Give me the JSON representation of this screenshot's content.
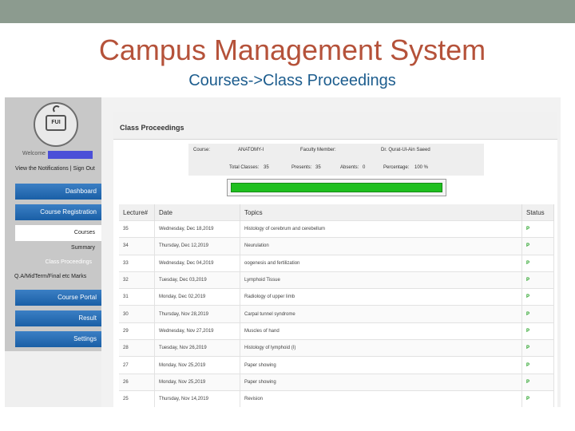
{
  "slide": {
    "title": "Campus Management System",
    "subtitle": "Courses->Class Proceedings"
  },
  "sidebar": {
    "logo_text": "FUI",
    "welcome": "Welcome",
    "notifications_link": "View the Notifications",
    "separator": "|",
    "signout_link": "Sign Out",
    "nav": [
      {
        "label": "Dashboard"
      },
      {
        "label": "Course Registration"
      },
      {
        "label": "Course Portal"
      },
      {
        "label": "Result"
      },
      {
        "label": "Settings"
      }
    ],
    "subitems": [
      {
        "label": "Courses"
      },
      {
        "label": "Summary"
      },
      {
        "label": "Class Proceedings"
      },
      {
        "label": "Q.A/MidTerm/Final etc Marks"
      }
    ]
  },
  "main": {
    "title": "Class Proceedings",
    "info": {
      "course_label": "Course:",
      "course_value": "ANATOMY-I",
      "faculty_label": "Faculty Member:",
      "faculty_value": "Dr. Qurat-Ul-Ain Saeed",
      "total_label": "Total Classes:",
      "total_value": "35",
      "presents_label": "Presents:",
      "presents_value": "35",
      "absents_label": "Absents:",
      "absents_value": "0",
      "percentage_label": "Percentage:",
      "percentage_value": "100 %"
    },
    "progress": 1.0,
    "progress_color": "#1fbf1f",
    "table": {
      "headers": [
        "Lecture#",
        "Date",
        "Topics",
        "Status"
      ],
      "rows": [
        [
          "35",
          "Wednesday, Dec 18,2019",
          "Histology of cerebrum and cerebellum",
          "P"
        ],
        [
          "34",
          "Thursday, Dec 12,2019",
          "Neurulation",
          "P"
        ],
        [
          "33",
          "Wednesday, Dec 04,2019",
          "oogenesis and fertilization",
          "P"
        ],
        [
          "32",
          "Tuesday, Dec 03,2019",
          "Lymphoid Tissue",
          "P"
        ],
        [
          "31",
          "Monday, Dec 02,2019",
          "Radiology of upper limb",
          "P"
        ],
        [
          "30",
          "Thursday, Nov 28,2019",
          "Carpal tunnel syndrome",
          "P"
        ],
        [
          "29",
          "Wednesday, Nov 27,2019",
          "Muscles of hand",
          "P"
        ],
        [
          "28",
          "Tuesday, Nov 26,2019",
          "Histology of lymphoid (I)",
          "P"
        ],
        [
          "27",
          "Monday, Nov 25,2019",
          "Paper showing",
          "P"
        ],
        [
          "26",
          "Monday, Nov 25,2019",
          "Paper showing",
          "P"
        ],
        [
          "25",
          "Thursday, Nov 14,2019",
          "Revision",
          "P"
        ]
      ]
    }
  }
}
